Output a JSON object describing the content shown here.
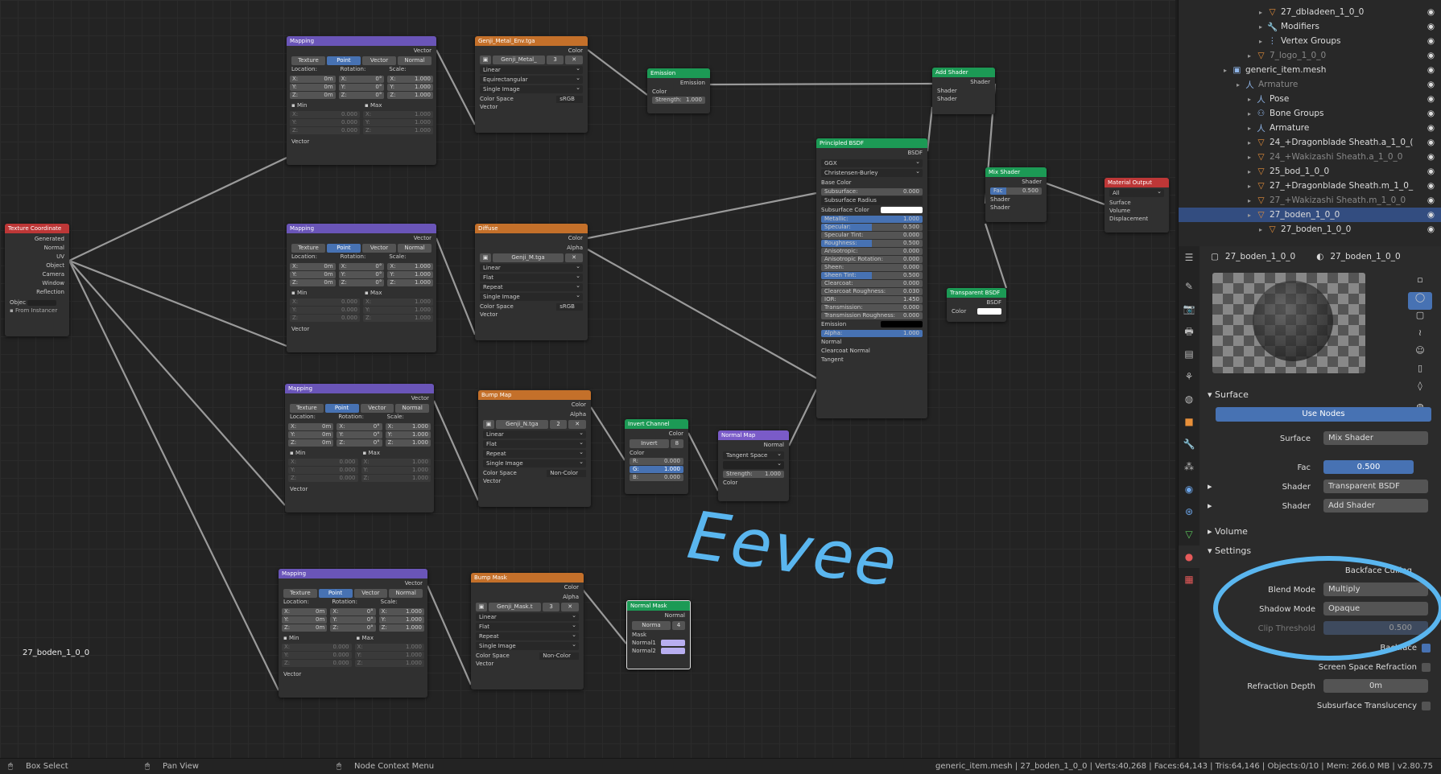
{
  "nodes": {
    "tex_coord": {
      "title": "Texture Coordinate",
      "outputs": [
        "Generated",
        "Normal",
        "UV",
        "Object",
        "Camera",
        "Window",
        "Reflection"
      ],
      "object_label": "Objec",
      "from_instancer": "From Instancer"
    },
    "mapping": {
      "title": "Mapping",
      "vector": "Vector",
      "types": [
        "Texture",
        "Point",
        "Vector",
        "Normal"
      ],
      "location": "Location:",
      "rotation": "Rotation:",
      "scale": "Scale:",
      "x": "X:",
      "y": "Y:",
      "z": "Z:",
      "loc_val": "0m",
      "rot_val": "0°",
      "scale_val": "1.000",
      "min": "Min",
      "max": "Max",
      "dim_val": "0.000",
      "dim_val2": "1.000",
      "vector_in": "Vector"
    },
    "metal_env": {
      "title": "Genji_Metal_Env.tga",
      "out": "Color",
      "image": "Genji_Metal_",
      "users": "3",
      "interp": "Linear",
      "proj": "Equirectangular",
      "source": "Single Image",
      "cs_label": "Color Space",
      "cs": "sRGB",
      "vec": "Vector"
    },
    "diffuse": {
      "title": "Diffuse",
      "out1": "Color",
      "out2": "Alpha",
      "image": "Genji_M.tga",
      "interp": "Linear",
      "proj": "Flat",
      "ext": "Repeat",
      "source": "Single Image",
      "cs_label": "Color Space",
      "cs": "sRGB",
      "vec": "Vector"
    },
    "bump": {
      "title": "Bump Map",
      "out1": "Color",
      "out2": "Alpha",
      "image": "Genji_N.tga",
      "users": "2",
      "interp": "Linear",
      "proj": "Flat",
      "ext": "Repeat",
      "source": "Single Image",
      "cs_label": "Color Space",
      "cs": "Non-Color",
      "vec": "Vector"
    },
    "bumpmask": {
      "title": "Bump Mask",
      "out1": "Color",
      "out2": "Alpha",
      "image": "Genji_Mask.t",
      "users": "3",
      "interp": "Linear",
      "proj": "Flat",
      "ext": "Repeat",
      "source": "Single Image",
      "cs_label": "Color Space",
      "cs": "Non-Color",
      "vec": "Vector"
    },
    "emission": {
      "title": "Emission",
      "out": "Emission",
      "color": "Color",
      "strength_label": "Strength:",
      "strength": "1.000"
    },
    "add_shader": {
      "title": "Add Shader",
      "out": "Shader",
      "in1": "Shader",
      "in2": "Shader"
    },
    "mix_shader": {
      "title": "Mix Shader",
      "out": "Shader",
      "fac_label": "Fac",
      "fac": "0.500",
      "in1": "Shader",
      "in2": "Shader"
    },
    "mat_out": {
      "title": "Material Output",
      "target": "All",
      "in1": "Surface",
      "in2": "Volume",
      "in3": "Displacement"
    },
    "transparent": {
      "title": "Transparent BSDF",
      "out": "BSDF",
      "color": "Color"
    },
    "invert": {
      "title": "Invert Channel",
      "out": "Color",
      "nodegroup": "Invert",
      "users": "8",
      "color": "Color",
      "r": "R:",
      "r_val": "0.000",
      "g": "G:",
      "g_val": "1.000",
      "b": "B:",
      "b_val": "0.000"
    },
    "normal_map": {
      "title": "Normal Map",
      "out": "Normal",
      "space": "Tangent Space",
      "strength_label": "Strength:",
      "strength": "1.000",
      "color": "Color"
    },
    "normal_mask": {
      "title": "Normal Mask",
      "out": "Normal",
      "nodegroup": "Norma",
      "users": "4",
      "mask": "Mask",
      "n1": "Normal1",
      "n2": "Normal2"
    },
    "principled": {
      "title": "Principled BSDF",
      "out": "BSDF",
      "dist": "GGX",
      "sss": "Christensen-Burley",
      "fields": [
        {
          "l": "Base Color",
          "v": "",
          "k": "label"
        },
        {
          "l": "Subsurface:",
          "v": "0.000",
          "k": "n"
        },
        {
          "l": "Subsurface Radius",
          "v": "",
          "k": "dd"
        },
        {
          "l": "Subsurface Color",
          "v": "",
          "k": "white"
        },
        {
          "l": "Metallic:",
          "v": "1.000",
          "k": "full"
        },
        {
          "l": "Specular:",
          "v": "0.500",
          "k": "half"
        },
        {
          "l": "Specular Tint:",
          "v": "0.000",
          "k": "n"
        },
        {
          "l": "Roughness:",
          "v": "0.500",
          "k": "half"
        },
        {
          "l": "Anisotropic:",
          "v": "0.000",
          "k": "n"
        },
        {
          "l": "Anisotropic Rotation:",
          "v": "0.000",
          "k": "n"
        },
        {
          "l": "Sheen:",
          "v": "0.000",
          "k": "n"
        },
        {
          "l": "Sheen Tint:",
          "v": "0.500",
          "k": "half"
        },
        {
          "l": "Clearcoat:",
          "v": "0.000",
          "k": "n"
        },
        {
          "l": "Clearcoat Roughness:",
          "v": "0.030",
          "k": "n"
        },
        {
          "l": "IOR:",
          "v": "1.450",
          "k": "n"
        },
        {
          "l": "Transmission:",
          "v": "0.000",
          "k": "n"
        },
        {
          "l": "Transmission Roughness:",
          "v": "0.000",
          "k": "n"
        },
        {
          "l": "Emission",
          "v": "",
          "k": "black"
        },
        {
          "l": "Alpha:",
          "v": "1.000",
          "k": "full"
        },
        {
          "l": "Normal",
          "v": "",
          "k": "label"
        },
        {
          "l": "Clearcoat Normal",
          "v": "",
          "k": "label"
        },
        {
          "l": "Tangent",
          "v": "",
          "k": "label"
        }
      ]
    }
  },
  "editor_object_name": "27_boden_1_0_0",
  "annotation": "Eevee",
  "outliner": [
    {
      "t": "27_dbladeen_1_0_0",
      "icon": "▽",
      "ind": 100,
      "dim": false
    },
    {
      "t": "Modifiers",
      "icon": "🔧",
      "ind": 100,
      "dim": false
    },
    {
      "t": "Vertex Groups",
      "icon": "⋮",
      "ind": 100,
      "dim": false
    },
    {
      "t": "7_logo_1_0_0",
      "icon": "▽",
      "ind": 86,
      "dim": true
    },
    {
      "t": "generic_item.mesh",
      "icon": "▣",
      "ind": 56,
      "dim": false
    },
    {
      "t": "Armature",
      "icon": "人",
      "ind": 72,
      "dim": true
    },
    {
      "t": "Pose",
      "icon": "人",
      "ind": 86,
      "dim": false
    },
    {
      "t": "Bone Groups",
      "icon": "⚇",
      "ind": 86,
      "dim": false
    },
    {
      "t": "Armature",
      "icon": "人",
      "ind": 86,
      "dim": false
    },
    {
      "t": "24_+Dragonblade Sheath.a_1_0_(",
      "icon": "▽",
      "ind": 86,
      "dim": false
    },
    {
      "t": "24_+Wakizashi Sheath.a_1_0_0",
      "icon": "▽",
      "ind": 86,
      "dim": true
    },
    {
      "t": "25_bod_1_0_0",
      "icon": "▽",
      "ind": 86,
      "dim": false
    },
    {
      "t": "27_+Dragonblade Sheath.m_1_0_",
      "icon": "▽",
      "ind": 86,
      "dim": false
    },
    {
      "t": "27_+Wakizashi Sheath.m_1_0_0",
      "icon": "▽",
      "ind": 86,
      "dim": true
    },
    {
      "t": "27_boden_1_0_0",
      "icon": "▽",
      "ind": 86,
      "dim": false,
      "sel": true
    },
    {
      "t": "27_boden_1_0_0",
      "icon": "▽",
      "ind": 100,
      "dim": false
    }
  ],
  "props": {
    "object": "27_boden_1_0_0",
    "material": "27_boden_1_0_0",
    "surface_section": "Surface",
    "use_nodes": "Use Nodes",
    "surface_label": "Surface",
    "surface_val": "Mix Shader",
    "fac_label": "Fac",
    "fac_val": "0.500",
    "shader1_label": "Shader",
    "shader1_val": "Transparent BSDF",
    "shader2_label": "Shader",
    "shader2_val": "Add Shader",
    "volume_section": "Volume",
    "settings_section": "Settings",
    "backface_culling": "Backface Culling",
    "blend_label": "Blend Mode",
    "blend_val": "Multiply",
    "shadow_label": "Shadow Mode",
    "shadow_val": "Opaque",
    "clip_label": "Clip Threshold",
    "clip_val": "0.500",
    "show_backface": "Backface",
    "ssr": "Screen Space Refraction",
    "refr_label": "Refraction Depth",
    "refr_val": "0m",
    "sss_trans": "Subsurface Translucency"
  },
  "status": {
    "box_select": "Box Select",
    "pan_view": "Pan View",
    "context_menu": "Node Context Menu",
    "info": "generic_item.mesh | 27_boden_1_0_0 | Verts:40,268 | Faces:64,143 | Tris:64,146 | Objects:0/10 | Mem: 266.0 MB | v2.80.75"
  }
}
